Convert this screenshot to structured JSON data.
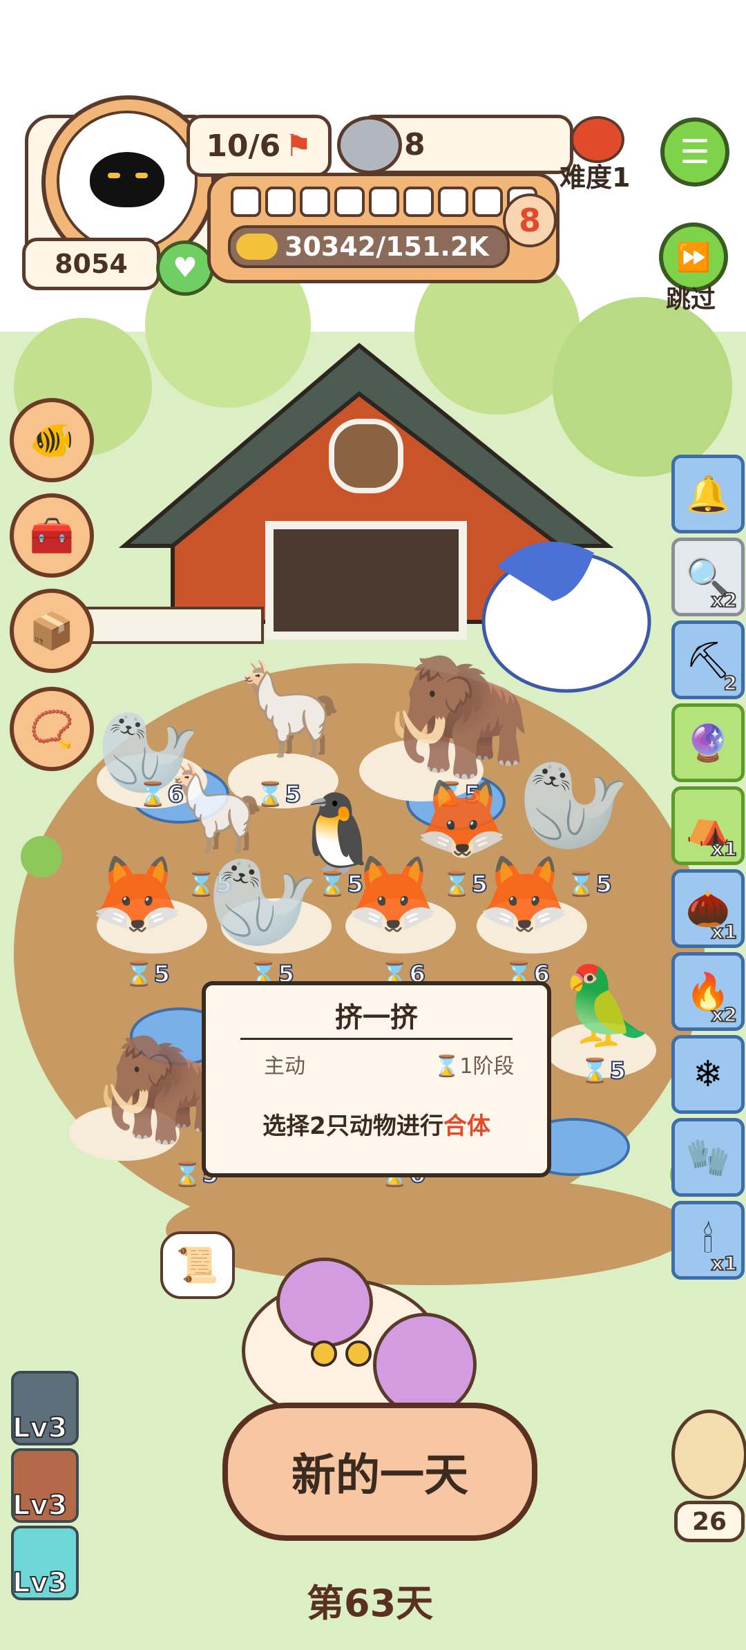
{
  "header": {
    "population": "10/6",
    "food_count": "8",
    "difficulty_label": "难度1",
    "level_number": "8",
    "gold_progress": "30342/151.2K",
    "heart_count": "8054",
    "skip_label": "跳过"
  },
  "progress": {
    "filled_segments": 0,
    "total_segments": 9
  },
  "popup": {
    "title": "挤一挤",
    "type_label": "主动",
    "stage_label": "1阶段",
    "description_prefix": "选择2只动物进行",
    "description_highlight": "合体"
  },
  "animals": [
    {
      "name": "seal",
      "timer": "6"
    },
    {
      "name": "alpaca",
      "timer": "5"
    },
    {
      "name": "mammoth",
      "timer": "5"
    },
    {
      "name": "walrus",
      "timer": "5"
    },
    {
      "name": "alpaca-2",
      "timer": "5"
    },
    {
      "name": "penguin-igloo",
      "timer": "5"
    },
    {
      "name": "fox",
      "timer": "5"
    },
    {
      "name": "fox-2",
      "timer": "5"
    },
    {
      "name": "fox-3",
      "timer": "6"
    },
    {
      "name": "walrus-2",
      "timer": "5"
    },
    {
      "name": "fox-4",
      "timer": "6"
    },
    {
      "name": "fox-5",
      "timer": "6"
    },
    {
      "name": "parrot",
      "timer": "5"
    },
    {
      "name": "mammoth-2",
      "timer": "5"
    },
    {
      "name": "bottom-slot",
      "timer": "6"
    }
  ],
  "side_items": [
    {
      "name": "bell",
      "badge": ""
    },
    {
      "name": "magnifier",
      "badge": "x2"
    },
    {
      "name": "shovel",
      "badge": "2"
    },
    {
      "name": "snow-globe",
      "badge": ""
    },
    {
      "name": "tent",
      "badge": "x1"
    },
    {
      "name": "seed-bag",
      "badge": "x1"
    },
    {
      "name": "fireplace",
      "badge": "x2"
    },
    {
      "name": "snowflake",
      "badge": ""
    },
    {
      "name": "mittens",
      "badge": ""
    },
    {
      "name": "candle-cake",
      "badge": "x1"
    }
  ],
  "level_slots": [
    {
      "label": "Lv3"
    },
    {
      "label": "Lv3"
    },
    {
      "label": "Lv3"
    }
  ],
  "main_button_label": "新的一天",
  "day_label": "第63天",
  "owl_count": "26",
  "colors": {
    "accent_red": "#e24a2c",
    "button_green": "#7fd34a",
    "barn_red": "#c9542a"
  }
}
